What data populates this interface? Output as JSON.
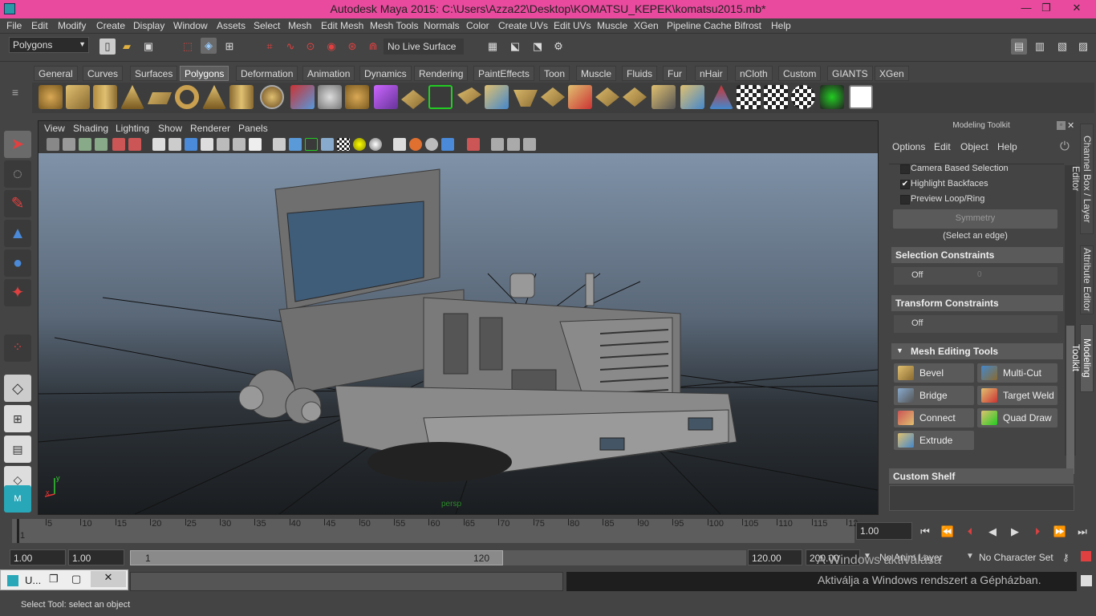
{
  "window": {
    "title": "Autodesk Maya 2015: C:\\Users\\Azza22\\Desktop\\KOMATSU_KEPEK\\komatsu2015.mb*",
    "min_glyph": "—",
    "max_glyph": "❐",
    "close_glyph": "✕"
  },
  "menubar": [
    "File",
    "Edit",
    "Modify",
    "Create",
    "Display",
    "Window",
    "Assets",
    "Select",
    "Mesh",
    "Edit Mesh",
    "Mesh Tools",
    "Normals",
    "Color",
    "Create UVs",
    "Edit UVs",
    "Muscle",
    "XGen",
    "Pipeline Cache",
    "Bifrost",
    "Help"
  ],
  "statusline": {
    "menuset": "Polygons",
    "live_surface": "No Live Surface"
  },
  "shelf": {
    "tabs": [
      "General",
      "Curves",
      "Surfaces",
      "Polygons",
      "Deformation",
      "Animation",
      "Dynamics",
      "Rendering",
      "PaintEffects",
      "Toon",
      "Muscle",
      "Fluids",
      "Fur",
      "nHair",
      "nCloth",
      "Custom",
      "GIANTS",
      "XGen"
    ],
    "active_tab": "Polygons"
  },
  "panel": {
    "menu": [
      "View",
      "Shading",
      "Lighting",
      "Show",
      "Renderer",
      "Panels"
    ],
    "camera_label": "persp",
    "axis_x": "x",
    "axis_y": "y"
  },
  "toolkit": {
    "title": "Modeling Toolkit",
    "menu": [
      "Options",
      "Edit",
      "Object",
      "Help"
    ],
    "camera_based_selection": "Camera Based Selection",
    "highlight_backfaces": "Highlight Backfaces",
    "preview_loop_ring": "Preview Loop/Ring",
    "symmetry": "Symmetry",
    "select_edge_hint": "(Select an edge)",
    "selection_constraints": "Selection Constraints",
    "sel_constraint_value": "Off",
    "sel_constraint_num": "0",
    "transform_constraints": "Transform Constraints",
    "transform_constraint_value": "Off",
    "mesh_editing_tools": "Mesh Editing Tools",
    "tools": [
      "Bevel",
      "Multi-Cut",
      "Bridge",
      "Target Weld",
      "Connect",
      "Quad Draw",
      "Extrude"
    ],
    "custom_shelf": "Custom Shelf",
    "checked": {
      "camera_based_selection": false,
      "highlight_backfaces": true,
      "preview_loop_ring": false
    }
  },
  "sidetabs": [
    "Channel Box / Layer Editor",
    "Attribute Editor",
    "Modeling Toolkit"
  ],
  "timeline": {
    "ticks": [
      "1",
      "5",
      "10",
      "15",
      "20",
      "25",
      "30",
      "35",
      "40",
      "45",
      "50",
      "55",
      "60",
      "65",
      "70",
      "75",
      "80",
      "85",
      "90",
      "95",
      "100",
      "105",
      "110",
      "115",
      "12"
    ],
    "current_time": "1.00"
  },
  "range": {
    "start": "1.00",
    "playback_start": "1.00",
    "slider_start": "1",
    "slider_end": "120",
    "playback_end": "120.00",
    "end": "200.00",
    "anim_layer": "No Anim Layer",
    "character_set": "No Character Set"
  },
  "cmdline": {
    "taskbar_item": "U...",
    "win_activate_title": "A Windows aktiválása",
    "win_activate_msg": "Aktiválja a Windows rendszert a Gépházban."
  },
  "helpline": "Select Tool: select an object",
  "colors": {
    "titlebar": "#e94a9e",
    "ui_bg": "#444444",
    "viewport_top": "#7f92a8",
    "accent_red": "#c62828"
  }
}
